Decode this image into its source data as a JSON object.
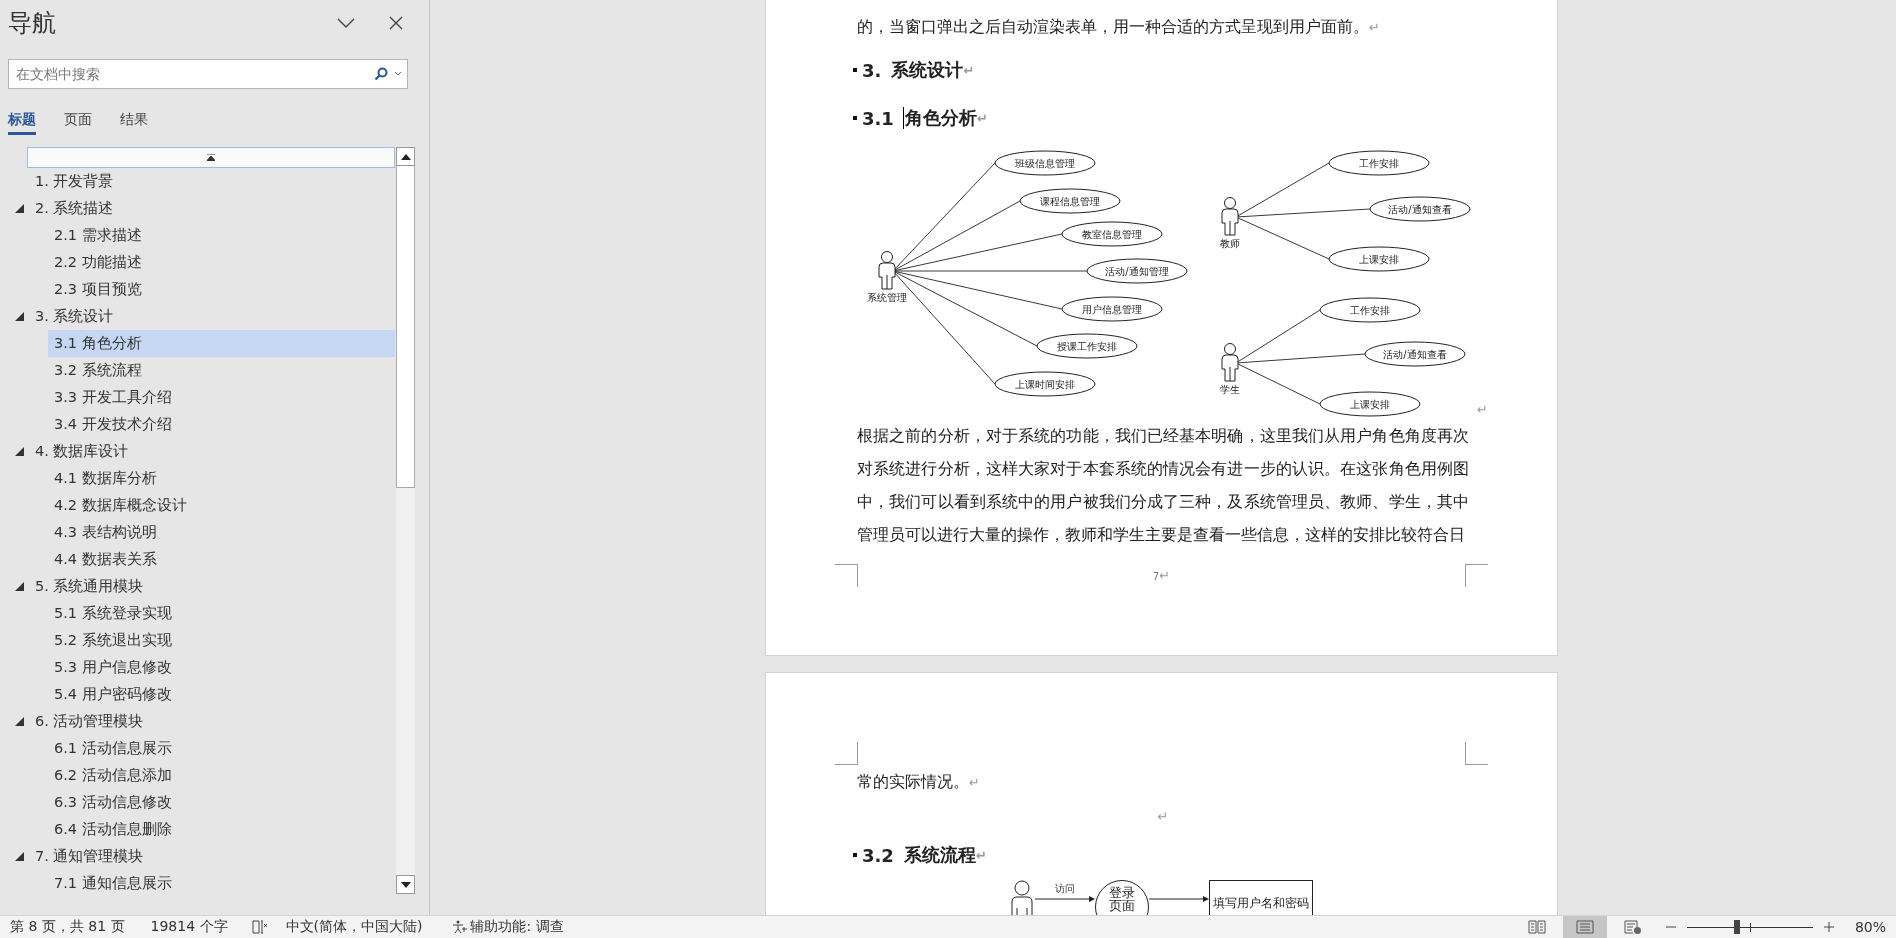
{
  "nav": {
    "title": "导航",
    "search": {
      "placeholder": "在文档中搜索"
    },
    "tabs": [
      {
        "label": "标题",
        "selected": true
      },
      {
        "label": "页面",
        "selected": false
      },
      {
        "label": "结果",
        "selected": false
      }
    ],
    "headings": [
      {
        "label": "1. 开发背景",
        "selected": false
      },
      {
        "label": "2. 系统描述",
        "selected": false,
        "expanded": true,
        "children": [
          {
            "label": "2.1 需求描述",
            "selected": false
          },
          {
            "label": "2.2 功能描述",
            "selected": false
          },
          {
            "label": "2.3 项目预览",
            "selected": false
          }
        ]
      },
      {
        "label": "3. 系统设计",
        "selected": false,
        "expanded": true,
        "children": [
          {
            "label": "3.1 角色分析",
            "selected": true
          },
          {
            "label": "3.2 系统流程",
            "selected": false
          },
          {
            "label": "3.3 开发工具介绍",
            "selected": false
          },
          {
            "label": "3.4 开发技术介绍",
            "selected": false
          }
        ]
      },
      {
        "label": "4. 数据库设计",
        "selected": false,
        "expanded": true,
        "children": [
          {
            "label": "4.1 数据库分析",
            "selected": false
          },
          {
            "label": "4.2 数据库概念设计",
            "selected": false
          },
          {
            "label": "4.3 表结构说明",
            "selected": false
          },
          {
            "label": "4.4 数据表关系",
            "selected": false
          }
        ]
      },
      {
        "label": "5. 系统通用模块",
        "selected": false,
        "expanded": true,
        "children": [
          {
            "label": "5.1 系统登录实现",
            "selected": false
          },
          {
            "label": "5.2 系统退出实现",
            "selected": false
          },
          {
            "label": "5.3 用户信息修改",
            "selected": false
          },
          {
            "label": "5.4 用户密码修改",
            "selected": false
          }
        ]
      },
      {
        "label": "6. 活动管理模块",
        "selected": false,
        "expanded": true,
        "children": [
          {
            "label": "6.1 活动信息展示",
            "selected": false
          },
          {
            "label": "6.2 活动信息添加",
            "selected": false
          },
          {
            "label": "6.3 活动信息修改",
            "selected": false
          },
          {
            "label": "6.4 活动信息删除",
            "selected": false
          }
        ]
      },
      {
        "label": "7. 通知管理模块",
        "selected": false,
        "expanded": true,
        "children": [
          {
            "label": "7.1 通知信息展示",
            "selected": false
          }
        ]
      }
    ]
  },
  "document": {
    "pages": [
      {
        "page_number": "7",
        "page_number_mark": "↵",
        "blocks": [
          {
            "kind": "paragraph",
            "text": "的，当窗口弹出之后自动渲染表单，用一种合适的方式呈现到用户面前。",
            "mark": "↵"
          },
          {
            "kind": "heading",
            "number": "3.",
            "text": "系统设计",
            "mark": "↵",
            "cursor": false
          },
          {
            "kind": "heading",
            "number": "3.1",
            "text": "角色分析",
            "mark": "↵",
            "cursor": true
          },
          {
            "kind": "use_case_diagram",
            "mark": "↵",
            "actors": [
              {
                "name": "系统管理",
                "use_cases": [
                  "班级信息管理",
                  "课程信息管理",
                  "教室信息管理",
                  "活动/通知管理",
                  "用户信息管理",
                  "授课工作安排",
                  "上课时间安排"
                ]
              },
              {
                "name": "教师",
                "use_cases": [
                  "工作安排",
                  "活动/通知查看",
                  "上课安排"
                ]
              },
              {
                "name": "学生",
                "use_cases": [
                  "工作安排",
                  "活动/通知查看",
                  "上课安排"
                ]
              }
            ]
          },
          {
            "kind": "paragraph",
            "text": "根据之前的分析，对于系统的功能，我们已经基本明确，这里我们从用户角色角度再次对系统进行分析，这样大家对于本套系统的情况会有进一步的认识。在这张角色用例图中，我们可以看到系统中的用户被我们分成了三种，及系统管理员、教师、学生，其中管理员可以进行大量的操作，教师和学生主要是查看一些信息，这样的安排比较符合日"
          }
        ]
      },
      {
        "blocks": [
          {
            "kind": "paragraph",
            "text": "常的实际情况。",
            "mark": "↵"
          },
          {
            "kind": "empty",
            "mark": "↵"
          },
          {
            "kind": "heading",
            "number": "3.2",
            "text": "系统流程",
            "mark": "↵",
            "cursor": false
          },
          {
            "kind": "flow_diagram",
            "arrow_label": "访问",
            "page_node": "登录页面",
            "step": "填写用户名和密码"
          }
        ]
      }
    ]
  },
  "status_bar": {
    "page": "第 8 页，共 81 页",
    "words": "19814 个字",
    "language": "中文(简体，中国大陆)",
    "accessibility": "辅助功能: 调查",
    "views": [
      {
        "kind": "read",
        "selected": false
      },
      {
        "kind": "print",
        "selected": true
      },
      {
        "kind": "web",
        "selected": false
      }
    ],
    "zoom": {
      "level": 0.4,
      "value": "80%"
    }
  }
}
